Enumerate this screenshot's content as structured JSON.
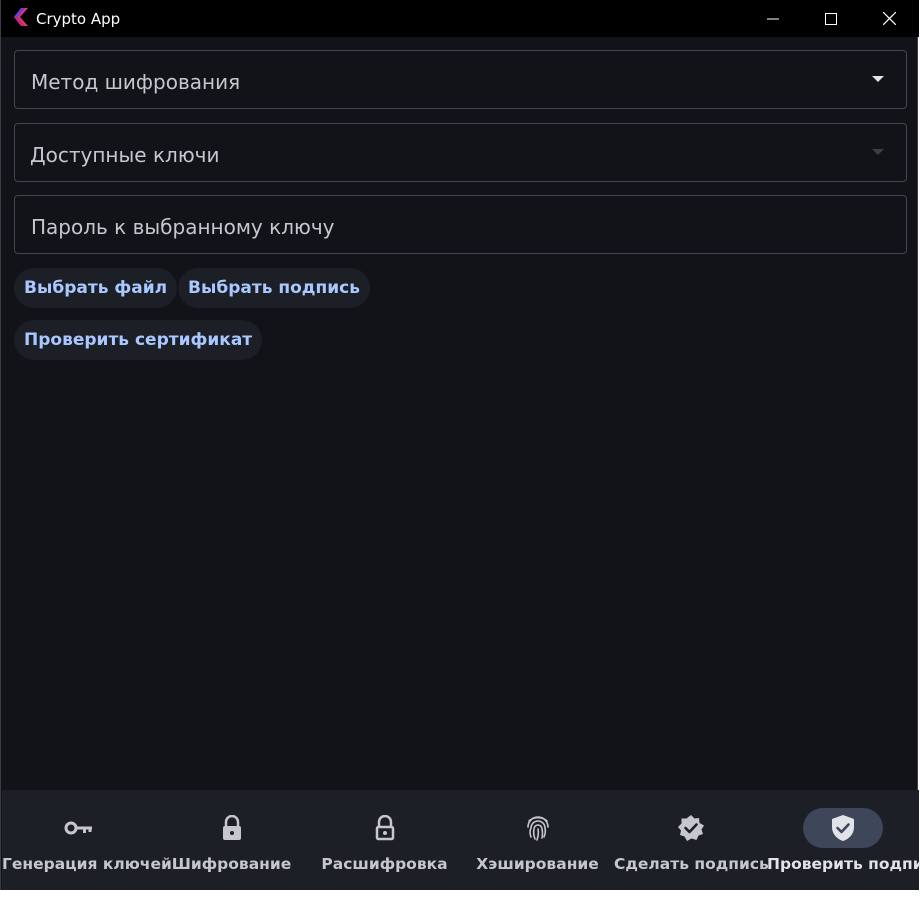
{
  "window": {
    "title": "Crypto App"
  },
  "form": {
    "encryption_method_label": "Метод шифрования",
    "available_keys_label": "Доступные ключи",
    "key_password_label": "Пароль к выбранному ключу"
  },
  "actions": {
    "choose_file": "Выбрать файл",
    "choose_signature": "Выбрать подпись",
    "check_certificate": "Проверить сертификат"
  },
  "nav": {
    "items": [
      {
        "label": "Генерация ключей",
        "icon": "key-icon",
        "active": false
      },
      {
        "label": "Шифрование",
        "icon": "lock-icon",
        "active": false
      },
      {
        "label": "Расшифровка",
        "icon": "lock-open-icon",
        "active": false
      },
      {
        "label": "Хэширование",
        "icon": "fingerprint-icon",
        "active": false
      },
      {
        "label": "Сделать подпись",
        "icon": "verified-badge-icon",
        "active": false
      },
      {
        "label": "Проверить подпись",
        "icon": "verified-shield-icon",
        "active": true
      }
    ]
  },
  "colors": {
    "background": "#111318",
    "accent_text": "#a8c8ff",
    "nav_background": "#1c1f26",
    "active_indicator": "#3e4759"
  }
}
